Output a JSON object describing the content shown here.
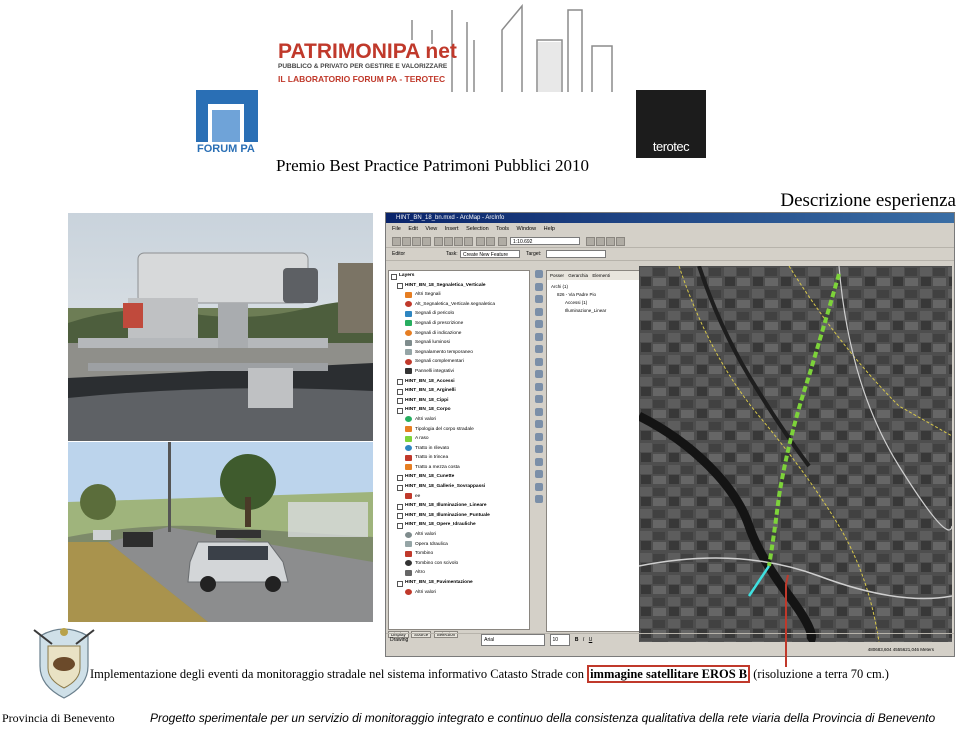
{
  "header": {
    "logo_patrimonipa": "PATRIMONIPA net",
    "logo_patrimonipa_sub": "PUBBLICO & PRIVATO PER GESTIRE E VALORIZZARE",
    "logo_patrimonipa_lab": "IL LABORATORIO FORUM PA - TEROTEC",
    "logo_forumpa": "FORUM PA",
    "logo_terotec": "terotec",
    "premio_title": "Premio Best Practice Patrimoni Pubblici 2010",
    "section_title": "Descrizione esperienza"
  },
  "arcmap": {
    "title": "HINT_BN_18_bn.mxd - ArcMap - ArcInfo",
    "menu": [
      "File",
      "Edit",
      "View",
      "Insert",
      "Selection",
      "Tools",
      "Window",
      "Help"
    ],
    "scale": "1:10.692",
    "editor_label": "Editor",
    "task_label": "Task:",
    "task_value": "Create New Feature",
    "target_label": "Target:",
    "toc_items": [
      "Layers",
      "HINT_BN_18_Segnaletica_Verticale",
      "Altri Segnali",
      "Alt_Segnaletica_Verticale.segnaletica",
      "Segnali di pericolo",
      "Segnali di prescrizione",
      "Segnali di indicazione",
      "Segnali luminosi",
      "Segnalamento temporaneo",
      "Segnali complementari",
      "Pannelli integrativi",
      "HINT_BN_18_Accessi",
      "HINT_BN_18_Arginelli",
      "HINT_BN_18_Cippi",
      "HINT_BN_18_Corpo",
      "Altri valori",
      "Tipologia del corpo stradale",
      "A raso",
      "Tratto in rilevato",
      "Tratto in trincea",
      "Tratto a mezza costa",
      "HINT_BN_18_Cunette",
      "HINT_BN_18_Gallerie_Sovrappassi",
      "ee",
      "HINT_BN_18_Illuminazione_Lineare",
      "HINT_BN_18_Illuminazione_Puntuale",
      "HINT_BN_18_Opere_Idrauliche",
      "Altri valori",
      "Opera Idraulica",
      "Tombino",
      "Tombino con scivolo",
      "Altro",
      "HINT_BN_18_Pavimentazione",
      "Altri valori"
    ],
    "toc_tabs": [
      "Display",
      "Source",
      "Selection"
    ],
    "catalog_tabs": [
      "Posser",
      "Gerarchia",
      "Elementi"
    ],
    "catalog_items": [
      "Archi (1)",
      "826 - Via Padre Pio",
      "Accessi (1)",
      "Illuminazione_Linear"
    ],
    "drawing_label": "Drawing",
    "font_name": "Arial",
    "font_size": "10",
    "status_coords": "480683,604  4555621,046 Meters",
    "colors": {
      "title_bar": "#0a246a",
      "window": "#d4d0c8",
      "road_overlay": "#7dd33a"
    }
  },
  "photos": {
    "top": "camera-mounted-on-vehicle",
    "bottom": "survey-vehicle-on-road"
  },
  "caption": {
    "before": "Implementazione degli eventi da monitoraggio stradale nel sistema informativo Catasto Strade con ",
    "highlight": "immagine satellitare EROS B",
    "after": " (risoluzione a terra 70 cm.)"
  },
  "footer": {
    "left": "Provincia di Benevento",
    "right": "Progetto sperimentale per un servizio di monitoraggio integrato e continuo della consistenza qualitativa della rete viaria della Provincia di Benevento"
  },
  "accent": "#c0392b"
}
